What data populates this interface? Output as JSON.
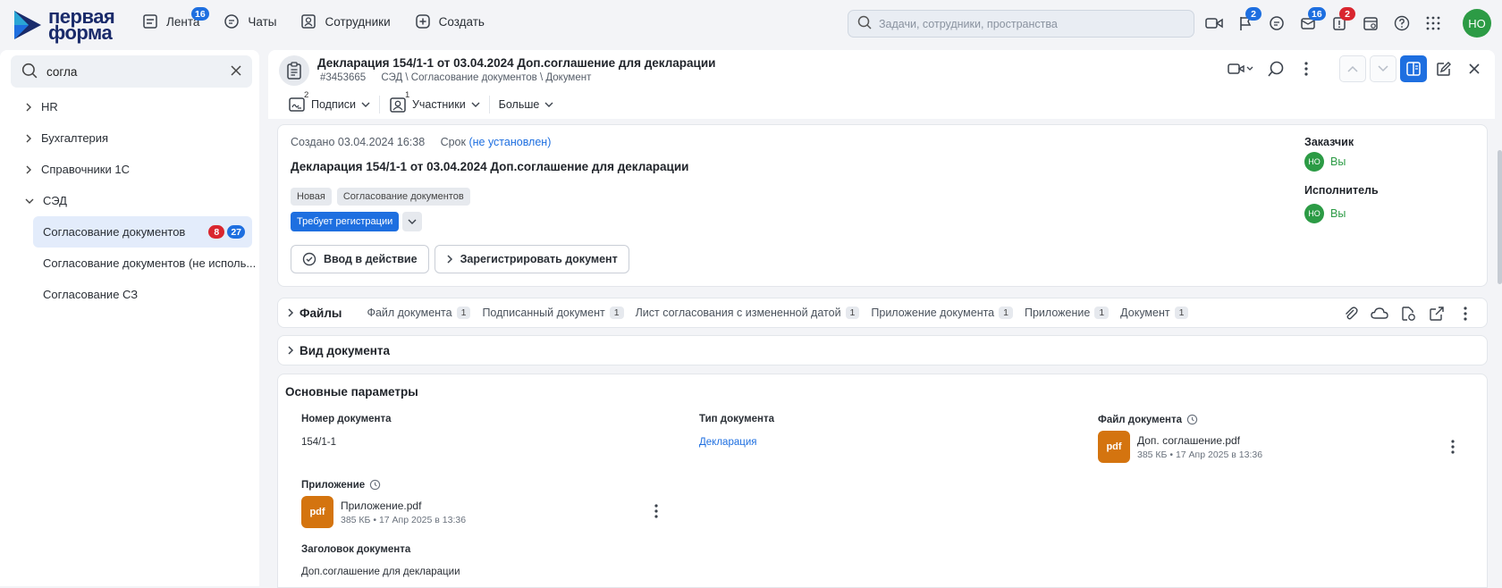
{
  "logo": {
    "line1": "первая",
    "line2": "форма"
  },
  "nav": [
    {
      "label": "Лента",
      "badge": "16",
      "icon": "feed-icon"
    },
    {
      "label": "Чаты",
      "icon": "chat-icon"
    },
    {
      "label": "Сотрудники",
      "icon": "people-icon"
    },
    {
      "label": "Создать",
      "icon": "plus-icon"
    }
  ],
  "search": {
    "placeholder": "Задачи, сотрудники, пространства"
  },
  "top_icons": {
    "flag_badge": "2",
    "mail_badge": "16",
    "alert_badge": "2"
  },
  "user": {
    "initials": "НО"
  },
  "sidebar": {
    "search_value": "согла",
    "items": [
      {
        "label": "HR"
      },
      {
        "label": "Бухгалтерия"
      },
      {
        "label": "Справочники 1С"
      },
      {
        "label": "СЭД"
      },
      {
        "label": "Согласование документов",
        "badge_red": "8",
        "badge_blue": "27"
      },
      {
        "label": "Согласование документов (не исполь..."
      },
      {
        "label": "Согласование СЗ"
      }
    ]
  },
  "header": {
    "title": "Декларация 154/1-1 от 03.04.2024 Доп.соглашение для декларации",
    "id": "#3453665",
    "path": "СЭД \\ Согласование документов \\ Документ"
  },
  "subbar": {
    "signatures": {
      "label": "Подписи",
      "count": "2"
    },
    "participants": {
      "label": "Участники",
      "count": "1"
    },
    "more": "Больше"
  },
  "card": {
    "created": "Создано 03.04.2024 16:38",
    "deadline_label": "Срок",
    "deadline_value": "(не установлен)",
    "title": "Декларация 154/1-1 от 03.04.2024 Доп.соглашение для декларации",
    "tags": [
      "Новая",
      "Согласование документов"
    ],
    "registration_tag": "Требует регистрации",
    "btn_enact": "Ввод в действие",
    "btn_register": "Зарегистрировать документ",
    "customer_label": "Заказчик",
    "customer": "Вы",
    "executor_label": "Исполнитель",
    "executor": "Вы"
  },
  "files": {
    "title": "Файлы",
    "tabs": [
      {
        "label": "Файл документа",
        "count": "1"
      },
      {
        "label": "Подписанный документ",
        "count": "1"
      },
      {
        "label": "Лист согласования с измененной датой",
        "count": "1"
      },
      {
        "label": "Приложение документа",
        "count": "1"
      },
      {
        "label": "Приложение",
        "count": "1"
      },
      {
        "label": "Документ",
        "count": "1"
      }
    ]
  },
  "doc_type_section": "Вид документа",
  "params": {
    "title": "Основные параметры",
    "number_label": "Номер документа",
    "number_value": "154/1-1",
    "type_label": "Тип документа",
    "type_value": "Декларация",
    "file_label": "Файл документа",
    "file": {
      "name": "Доп. соглашение.pdf",
      "meta": "385 КБ • 17 Апр 2025 в 13:36",
      "ext": "pdf"
    },
    "attach_label": "Приложение",
    "attach": {
      "name": "Приложение.pdf",
      "meta": "385 КБ • 17 Апр 2025 в 13:36",
      "ext": "pdf"
    },
    "heading_label": "Заголовок документа",
    "heading_value": "Доп.соглашение для декларации"
  }
}
